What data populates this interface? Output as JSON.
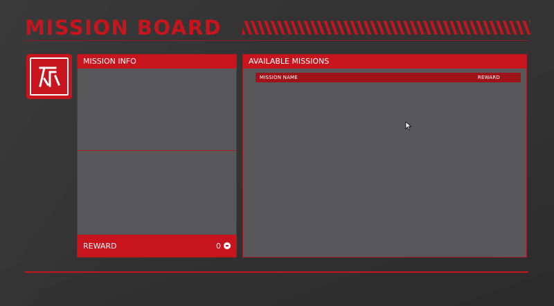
{
  "header": {
    "title": "MISSION BOARD"
  },
  "mission_info": {
    "title": "MISSION INFO",
    "reward_label": "REWARD",
    "reward_value": "0",
    "reward_icon": "coin-icon"
  },
  "available_missions": {
    "title": "AVAILABLE MISSIONS",
    "columns": [
      "MISSION NAME",
      "REWARD"
    ],
    "rows": []
  },
  "colors": {
    "accent": "#c8141c",
    "panel": "#58585a",
    "background": "#333333"
  }
}
